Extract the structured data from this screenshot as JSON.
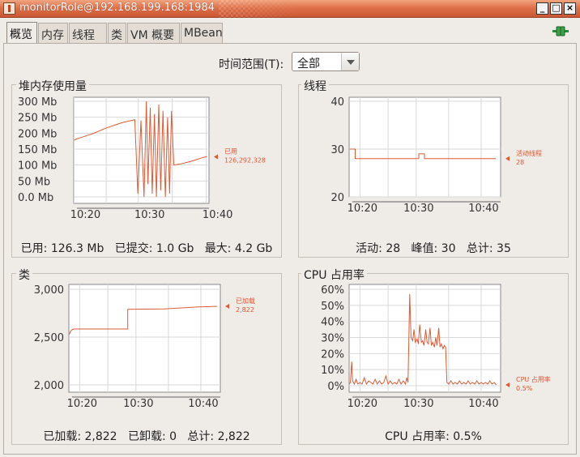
{
  "window": {
    "title": "monitorRole@192.168.199.168:1984"
  },
  "tabs": [
    {
      "label": "概览",
      "active": true
    },
    {
      "label": "内存",
      "active": false
    },
    {
      "label": "线程",
      "active": false
    },
    {
      "label": "类",
      "active": false
    },
    {
      "label": "VM 概要",
      "active": false
    },
    {
      "label": "MBean",
      "active": false
    }
  ],
  "icons": {
    "app": "java-cup-icon",
    "connection": "connection-plug-icon"
  },
  "time_range": {
    "label": "时间范围(T):",
    "value": "全部"
  },
  "colors": {
    "accent": "#e0714a",
    "line": "#dd5a34",
    "plot_bg": "#ffffff",
    "grid": "#d8d8d8"
  },
  "panels": {
    "heap": {
      "title": "堆内存使用量",
      "summary": {
        "used_label": "已用:",
        "used": "126.3 Mb",
        "committed_label": "已提交:",
        "committed": "1.0 Gb",
        "max_label": "最大:",
        "max": "4.2 Gb"
      }
    },
    "threads": {
      "title": "线程",
      "summary": {
        "live_label": "活动:",
        "live": "28",
        "peak_label": "峰值:",
        "peak": "30",
        "total_label": "总计:",
        "total": "35"
      }
    },
    "classes": {
      "title": "类",
      "summary": {
        "loaded_label": "已加载:",
        "loaded": "2,822",
        "unloaded_label": "已卸载:",
        "unloaded": "0",
        "total_label": "总计:",
        "total": "2,822"
      }
    },
    "cpu": {
      "title": "CPU 占用率",
      "summary": {
        "label": "CPU 占用率:",
        "value": "0.5%"
      }
    }
  },
  "chart_data": [
    {
      "id": "heap",
      "type": "line",
      "yticks": [
        "300 Mb",
        "250 Mb",
        "200 Mb",
        "150 Mb",
        "100 Mb",
        "50 Mb",
        "0.0 Mb"
      ],
      "ylim": [
        0,
        300
      ],
      "xticks": [
        "10:20",
        "10:30",
        "10:40"
      ],
      "legend": {
        "label": "已用",
        "value": "126,292,328"
      },
      "series": [
        {
          "values": [
            [
              10.1,
              178
            ],
            [
              10.8,
              182
            ],
            [
              11.8,
              186
            ],
            [
              12.8,
              190
            ],
            [
              13.8,
              194
            ],
            [
              14.8,
              198
            ],
            [
              15.8,
              203
            ],
            [
              16.8,
              208
            ],
            [
              17.8,
              213
            ],
            [
              18.8,
              218
            ],
            [
              19.8,
              222
            ],
            [
              20.8,
              226
            ],
            [
              21.8,
              230
            ],
            [
              22.8,
              234
            ],
            [
              24.3,
              238
            ],
            [
              25.8,
              242
            ],
            [
              26.6,
              10
            ],
            [
              27.4,
              240
            ],
            [
              28.2,
              0
            ],
            [
              28.8,
              300
            ],
            [
              29.2,
              40
            ],
            [
              29.8,
              280
            ],
            [
              30.3,
              10
            ],
            [
              30.9,
              260
            ],
            [
              31.4,
              0
            ],
            [
              32.0,
              290
            ],
            [
              32.5,
              20
            ],
            [
              33.1,
              270
            ],
            [
              33.7,
              0
            ],
            [
              34.3,
              250
            ],
            [
              34.8,
              10
            ],
            [
              35.3,
              270
            ],
            [
              35.9,
              100
            ],
            [
              36.5,
              101
            ],
            [
              37.5,
              103
            ],
            [
              38.5,
              106
            ],
            [
              39.5,
              109
            ],
            [
              40.5,
              112
            ],
            [
              41.5,
              116
            ],
            [
              42.5,
              120
            ],
            [
              43.5,
              124
            ],
            [
              44.5,
              126
            ]
          ]
        }
      ]
    },
    {
      "id": "threads",
      "type": "line",
      "yticks": [
        "40",
        "30",
        "20"
      ],
      "ylim": [
        20,
        40
      ],
      "xticks": [
        "10:20",
        "10:30",
        "10:40"
      ],
      "legend": {
        "label": "活动线程",
        "value": "28"
      },
      "series": [
        {
          "values": [
            [
              10.1,
              30
            ],
            [
              11.4,
              30
            ],
            [
              11.4,
              28
            ],
            [
              26.1,
              28
            ],
            [
              26.1,
              29
            ],
            [
              27.4,
              29
            ],
            [
              27.4,
              28
            ],
            [
              43.9,
              28
            ]
          ]
        }
      ]
    },
    {
      "id": "classes",
      "type": "line",
      "yticks": [
        "3,000",
        "2,500",
        "2,000"
      ],
      "ylim": [
        2000,
        3000
      ],
      "xticks": [
        "10:20",
        "10:30",
        "10:40"
      ],
      "legend": {
        "label": "已加载",
        "value": "2,822"
      },
      "series": [
        {
          "values": [
            [
              10.1,
              2530
            ],
            [
              10.4,
              2560
            ],
            [
              10.8,
              2580
            ],
            [
              11.2,
              2585
            ],
            [
              23.6,
              2585
            ],
            [
              23.6,
              2790
            ],
            [
              32.0,
              2795
            ],
            [
              36.0,
              2805
            ],
            [
              40.0,
              2815
            ],
            [
              44.3,
              2822
            ]
          ]
        }
      ]
    },
    {
      "id": "cpu",
      "type": "line",
      "yticks": [
        "60%",
        "50%",
        "40%",
        "30%",
        "20%",
        "10%",
        "0%"
      ],
      "ylim": [
        0,
        60
      ],
      "xticks": [
        "10:20",
        "10:30",
        "10:40"
      ],
      "legend": {
        "label": "CPU 占用率",
        "value": "0.5%"
      },
      "series": [
        {
          "values": [
            [
              10.0,
              1
            ],
            [
              10.3,
              2
            ],
            [
              10.6,
              15
            ],
            [
              10.8,
              3
            ],
            [
              11.2,
              1
            ],
            [
              11.6,
              4
            ],
            [
              12.0,
              1
            ],
            [
              12.5,
              2
            ],
            [
              13.0,
              1
            ],
            [
              13.5,
              5
            ],
            [
              14.0,
              1
            ],
            [
              14.5,
              3
            ],
            [
              15.0,
              2
            ],
            [
              15.5,
              1
            ],
            [
              16.0,
              4
            ],
            [
              16.5,
              1
            ],
            [
              17.0,
              3
            ],
            [
              17.5,
              1
            ],
            [
              18.0,
              2
            ],
            [
              18.5,
              6
            ],
            [
              19.0,
              1
            ],
            [
              19.5,
              3
            ],
            [
              20.0,
              1
            ],
            [
              20.5,
              2
            ],
            [
              21.0,
              1
            ],
            [
              21.5,
              4
            ],
            [
              22.0,
              1
            ],
            [
              22.5,
              3
            ],
            [
              23.0,
              1
            ],
            [
              23.3,
              5
            ],
            [
              23.6,
              2
            ],
            [
              24.0,
              57
            ],
            [
              24.3,
              30
            ],
            [
              24.7,
              28
            ],
            [
              25.0,
              35
            ],
            [
              25.3,
              27
            ],
            [
              25.7,
              29
            ],
            [
              26.0,
              26
            ],
            [
              26.3,
              38
            ],
            [
              26.7,
              27
            ],
            [
              27.0,
              28
            ],
            [
              27.3,
              25
            ],
            [
              27.7,
              35
            ],
            [
              28.0,
              27
            ],
            [
              28.3,
              26
            ],
            [
              28.7,
              36
            ],
            [
              29.0,
              25
            ],
            [
              29.3,
              27
            ],
            [
              29.7,
              24
            ],
            [
              30.0,
              30
            ],
            [
              30.3,
              25
            ],
            [
              30.7,
              36
            ],
            [
              31.0,
              24
            ],
            [
              31.3,
              26
            ],
            [
              31.7,
              23
            ],
            [
              32.0,
              25
            ],
            [
              32.3,
              24
            ],
            [
              32.6,
              2
            ],
            [
              33.0,
              1
            ],
            [
              33.5,
              3
            ],
            [
              34.0,
              1
            ],
            [
              34.5,
              2
            ],
            [
              35.0,
              1
            ],
            [
              35.5,
              3
            ],
            [
              36.0,
              1
            ],
            [
              36.5,
              2
            ],
            [
              37.0,
              1
            ],
            [
              37.5,
              3
            ],
            [
              38.0,
              1
            ],
            [
              38.5,
              2
            ],
            [
              39.0,
              1
            ],
            [
              39.5,
              3
            ],
            [
              40.0,
              1
            ],
            [
              40.5,
              2
            ],
            [
              41.0,
              1
            ],
            [
              41.5,
              2
            ],
            [
              42.0,
              1
            ],
            [
              42.5,
              3
            ],
            [
              43.0,
              1
            ],
            [
              43.5,
              2
            ],
            [
              44.0,
              0.5
            ]
          ]
        }
      ]
    }
  ]
}
